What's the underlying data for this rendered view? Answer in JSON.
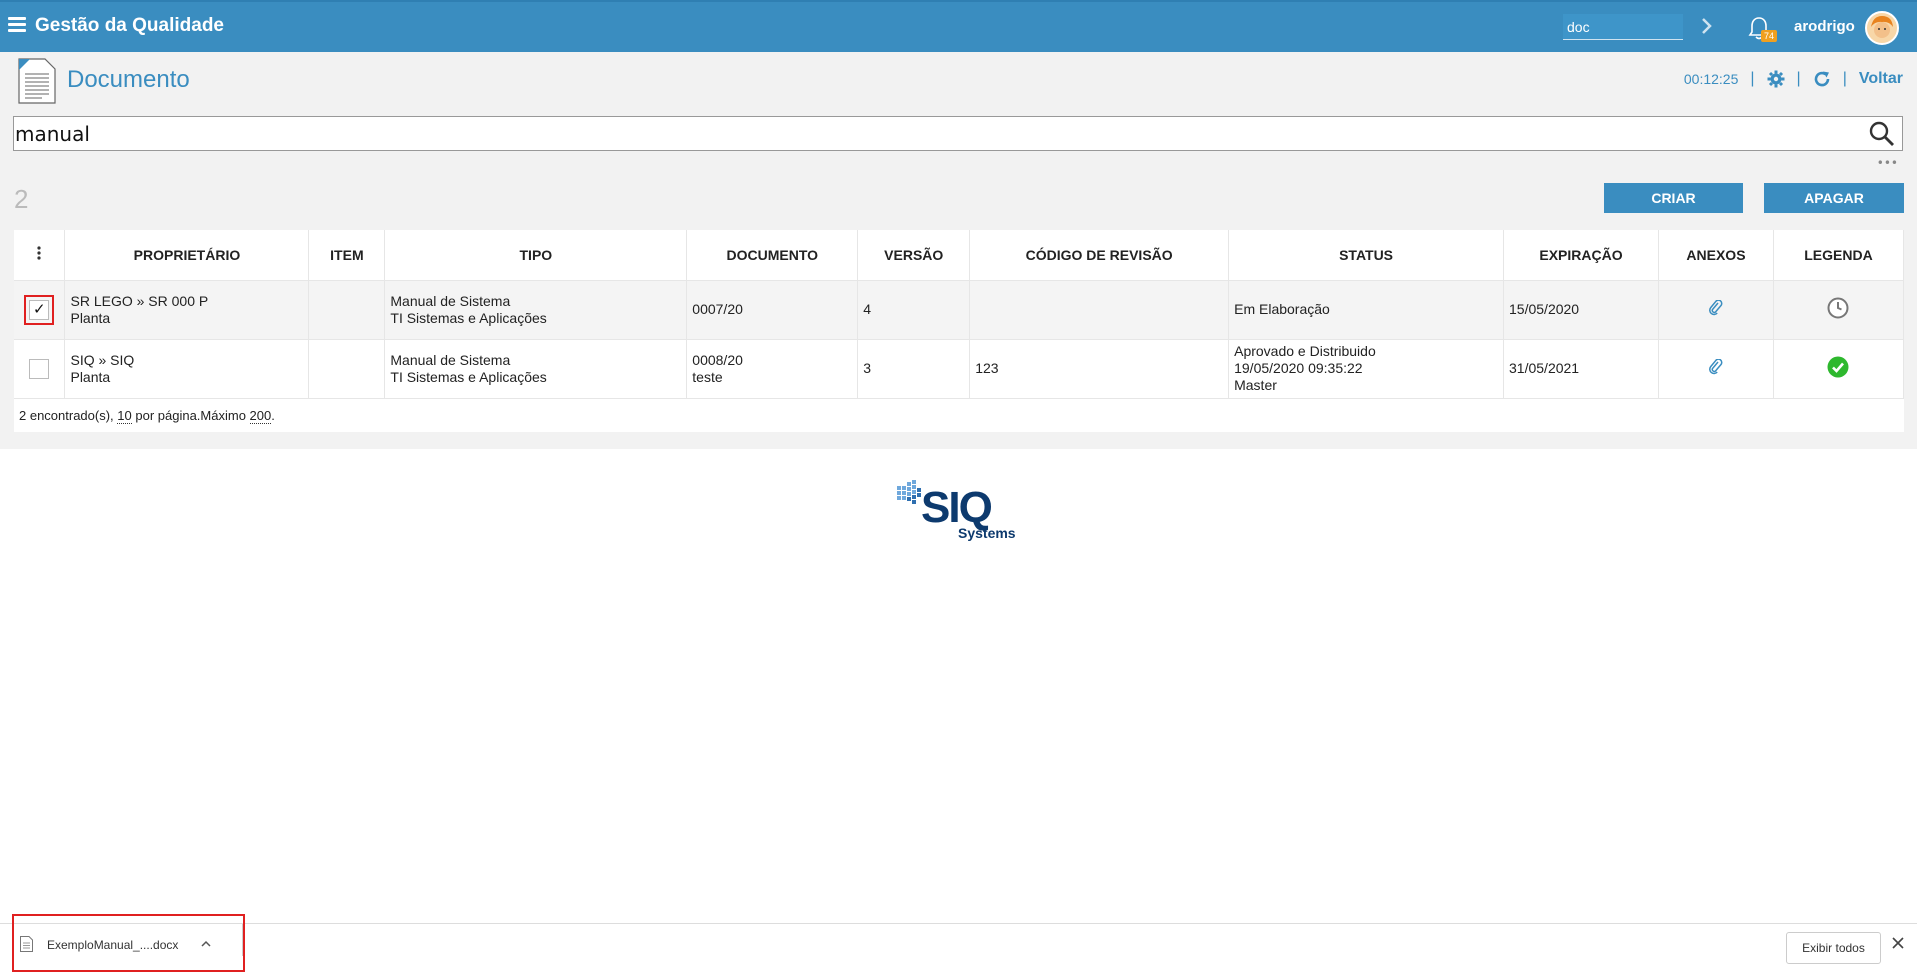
{
  "header": {
    "app_title": "Gestão da Qualidade",
    "search_value": "doc",
    "notification_count": "74",
    "username": "arodrigo"
  },
  "page": {
    "title": "Documento",
    "timer": "00:12:25",
    "separator": "|",
    "back_label": "Voltar",
    "more_label": "•••"
  },
  "search": {
    "value": "manual"
  },
  "results": {
    "count": "2",
    "create_label": "CRIAR",
    "delete_label": "APAGAR"
  },
  "table": {
    "columns": [
      "PROPRIETÁRIO",
      "ITEM",
      "TIPO",
      "DOCUMENTO",
      "VERSÃO",
      "CÓDIGO DE REVISÃO",
      "STATUS",
      "EXPIRAÇÃO",
      "ANEXOS",
      "LEGENDA"
    ],
    "rows": [
      {
        "checked": true,
        "checkmark": "✓",
        "owner_line1": "SR LEGO » SR 000 P",
        "owner_line2": "Planta",
        "item": "",
        "type_line1": "Manual de Sistema",
        "type_line2": "TI Sistemas e Aplicações",
        "document_line1": "0007/20",
        "document_line2": "",
        "version": "4",
        "revision_code": "",
        "status_line1": "Em Elaboração",
        "status_line2": "",
        "status_line3": "",
        "expiration": "15/05/2020",
        "legend_icon": "clock-icon"
      },
      {
        "checked": false,
        "checkmark": "",
        "owner_line1": "SIQ » SIQ",
        "owner_line2": "Planta",
        "item": "",
        "type_line1": "Manual de Sistema",
        "type_line2": "TI Sistemas e Aplicações",
        "document_line1": "0008/20",
        "document_line2": "teste",
        "version": "3",
        "revision_code": "123",
        "status_line1": "Aprovado e Distribuido",
        "status_line2": "19/05/2020 09:35:22",
        "status_line3": "Master",
        "expiration": "31/05/2021",
        "legend_icon": "check-circle-icon"
      }
    ],
    "footer": {
      "found_text": "2 encontrado(s), ",
      "per_page_value": "10",
      "per_page_text": " por página.Máximo ",
      "max_value": "200",
      "end_text": "."
    }
  },
  "logo": {
    "brand": "SIQ",
    "sub": "Systems"
  },
  "downloads": {
    "file_name": "ExemploManual_....docx",
    "show_all_label": "Exibir todos"
  },
  "colors": {
    "primary": "#3a8dc0",
    "highlight_border": "#e02020",
    "status_ok": "#2eb82e",
    "logo_navy": "#0d3a6e"
  }
}
